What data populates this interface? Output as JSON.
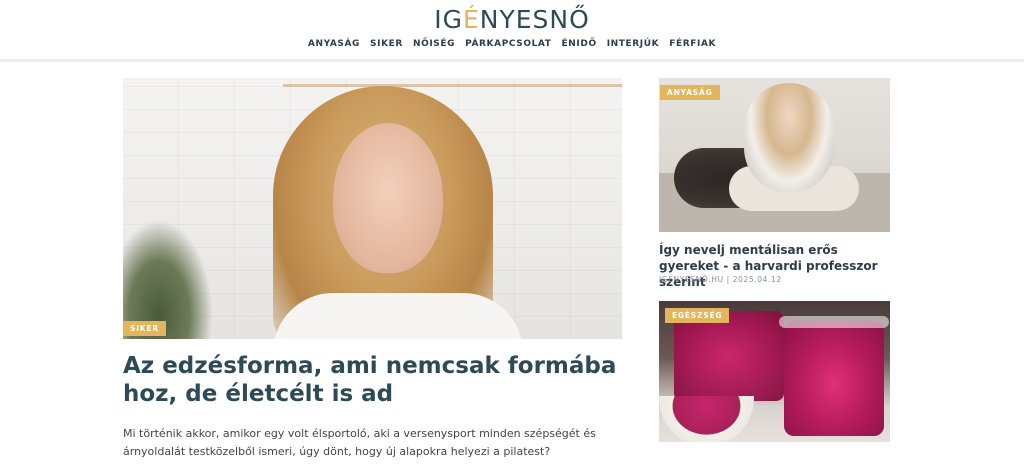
{
  "brand": {
    "prefix": "IG",
    "accent": "É",
    "suffix": "NYESNŐ"
  },
  "nav": [
    "ANYASÁG",
    "SIKER",
    "NŐISÉG",
    "PÁRKAPCSOLAT",
    "ÉNIDŐ",
    "INTERJÚK",
    "FÉRFIAK"
  ],
  "featured": {
    "category": "SIKER",
    "title": "Az edzésforma, ami nemcsak formába hoz, de életcélt is ad",
    "excerpt": "Mi történik akkor, amikor egy volt élsportoló, aki a versenysport minden szépségét és árnyoldalát testközelből ismeri, úgy dönt, hogy új alapokra helyezi a pilatest?"
  },
  "side_articles": [
    {
      "category": "ANYASÁG",
      "title": "Így nevelj mentálisan erős gyereket - a harvardi professzor szerint",
      "meta": "IGÉNYESNŐ.HU | 2025.04.12"
    },
    {
      "category": "EGÉSZSÉG"
    }
  ],
  "colors": {
    "accent": "#e3b55c",
    "heading": "#2f4a57",
    "text": "#444444"
  }
}
